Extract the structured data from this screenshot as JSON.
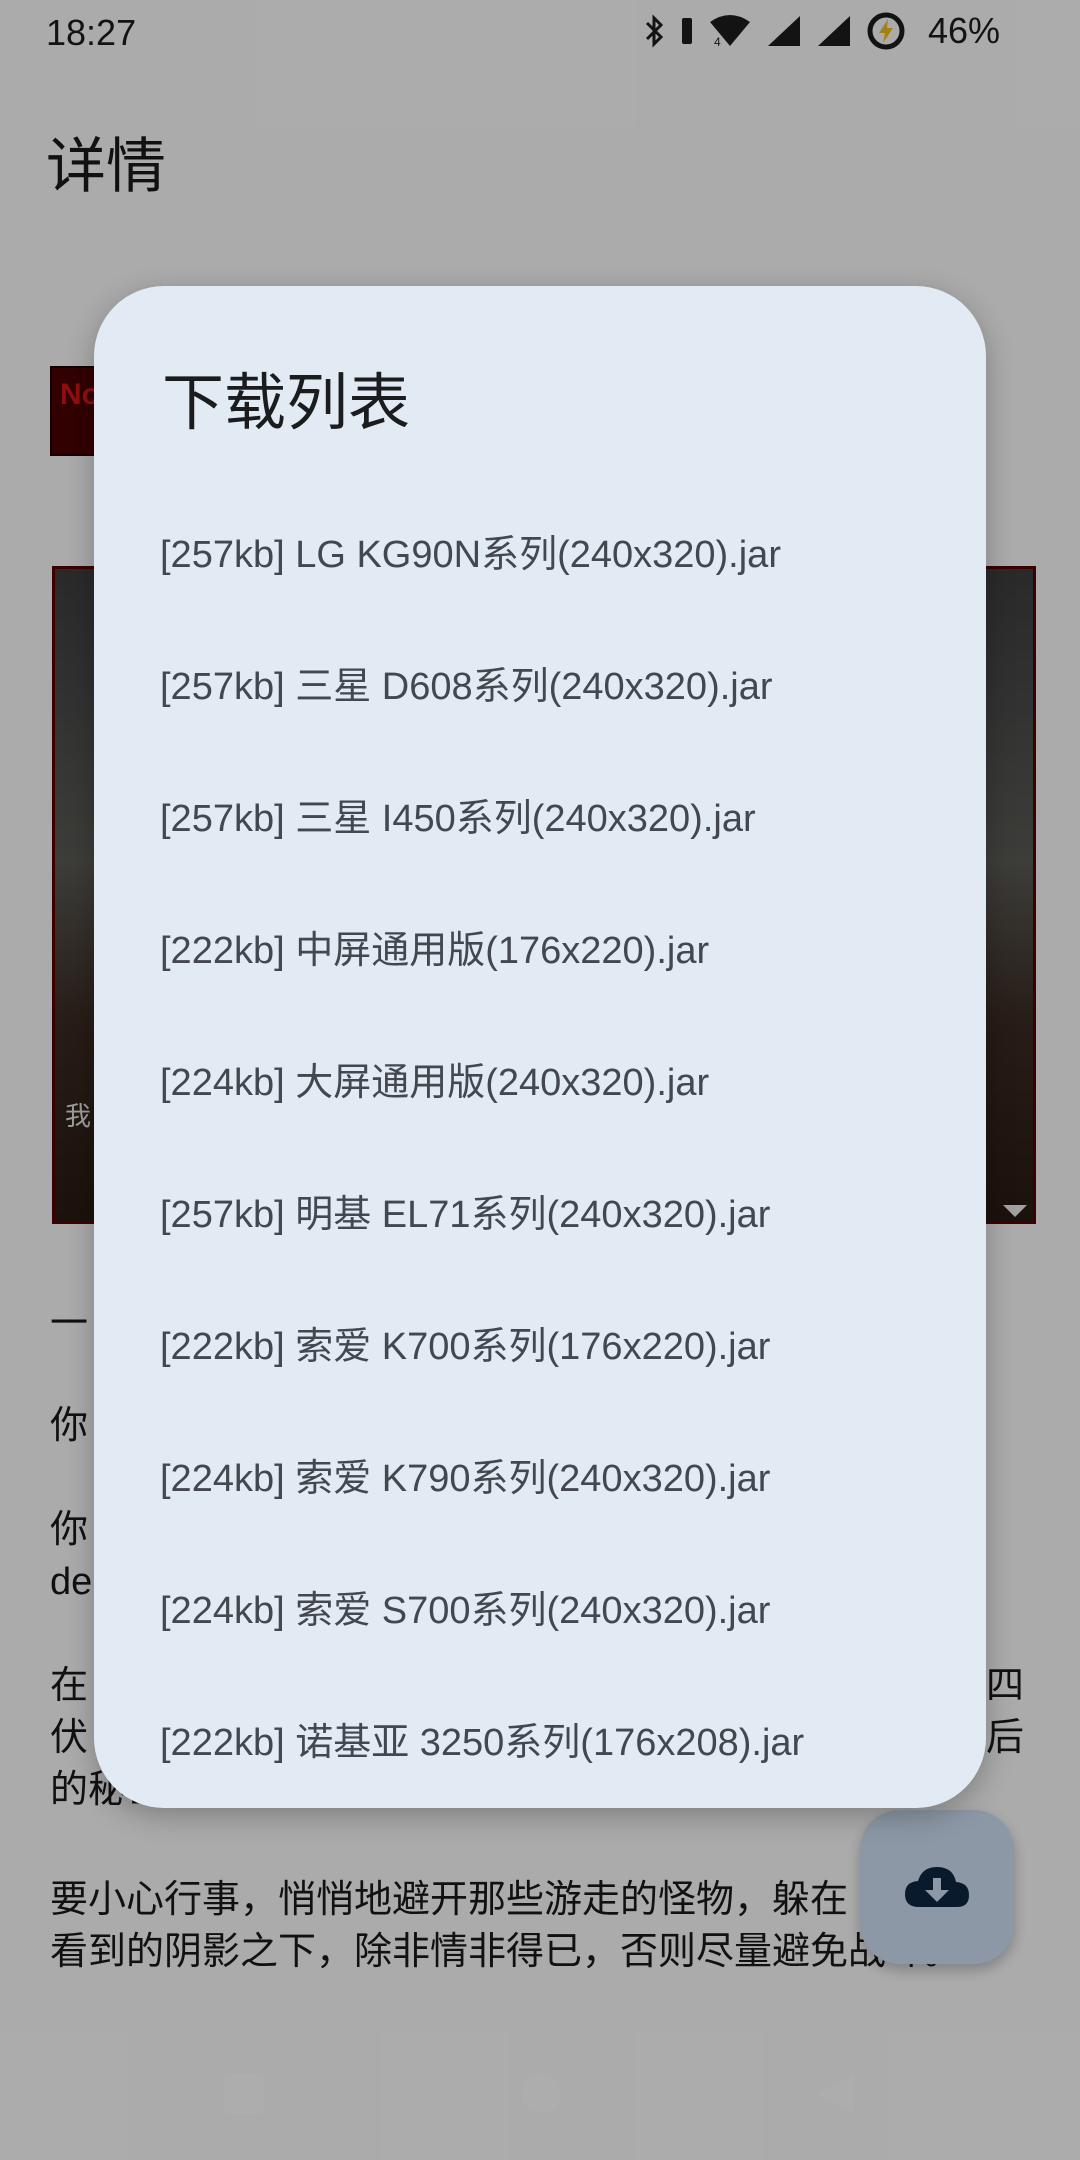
{
  "status_bar": {
    "time": "18:27",
    "battery_percent": "46%",
    "network_label": "4"
  },
  "page": {
    "title": "详情",
    "thumbnail_text": "No",
    "screenshot_caption": "我",
    "desc_lines": [
      "一",
      "你",
      "你",
      "de",
      "在",
      "四",
      "伏",
      "后",
      "的秘密。",
      "要小心行事，悄悄地避开那些游走的怪物，躲在",
      "看到的阴影之下，除非情非得已，否则尽量避免战斗。"
    ]
  },
  "dialog": {
    "title": "下载列表",
    "items": [
      "[257kb] LG KG90N系列(240x320).jar",
      "[257kb] 三星 D608系列(240x320).jar",
      "[257kb] 三星 I450系列(240x320).jar",
      "[222kb] 中屏通用版(176x220).jar",
      "[224kb] 大屏通用版(240x320).jar",
      "[257kb] 明基 EL71系列(240x320).jar",
      "[222kb] 索爱 K700系列(176x220).jar",
      "[224kb] 索爱 K790系列(240x320).jar",
      "[224kb] 索爱 S700系列(240x320).jar",
      "[222kb] 诺基亚 3250系列(176x208).jar"
    ]
  },
  "icons": {
    "fab": "cloud-download-icon",
    "nav_recents": "square-icon",
    "nav_home": "circle-icon",
    "nav_back": "triangle-back-icon"
  },
  "colors": {
    "dialog_bg": "#e2ebf4",
    "fab_bg": "#cfe0f5",
    "scrim": "rgba(0,0,0,0.32)"
  }
}
